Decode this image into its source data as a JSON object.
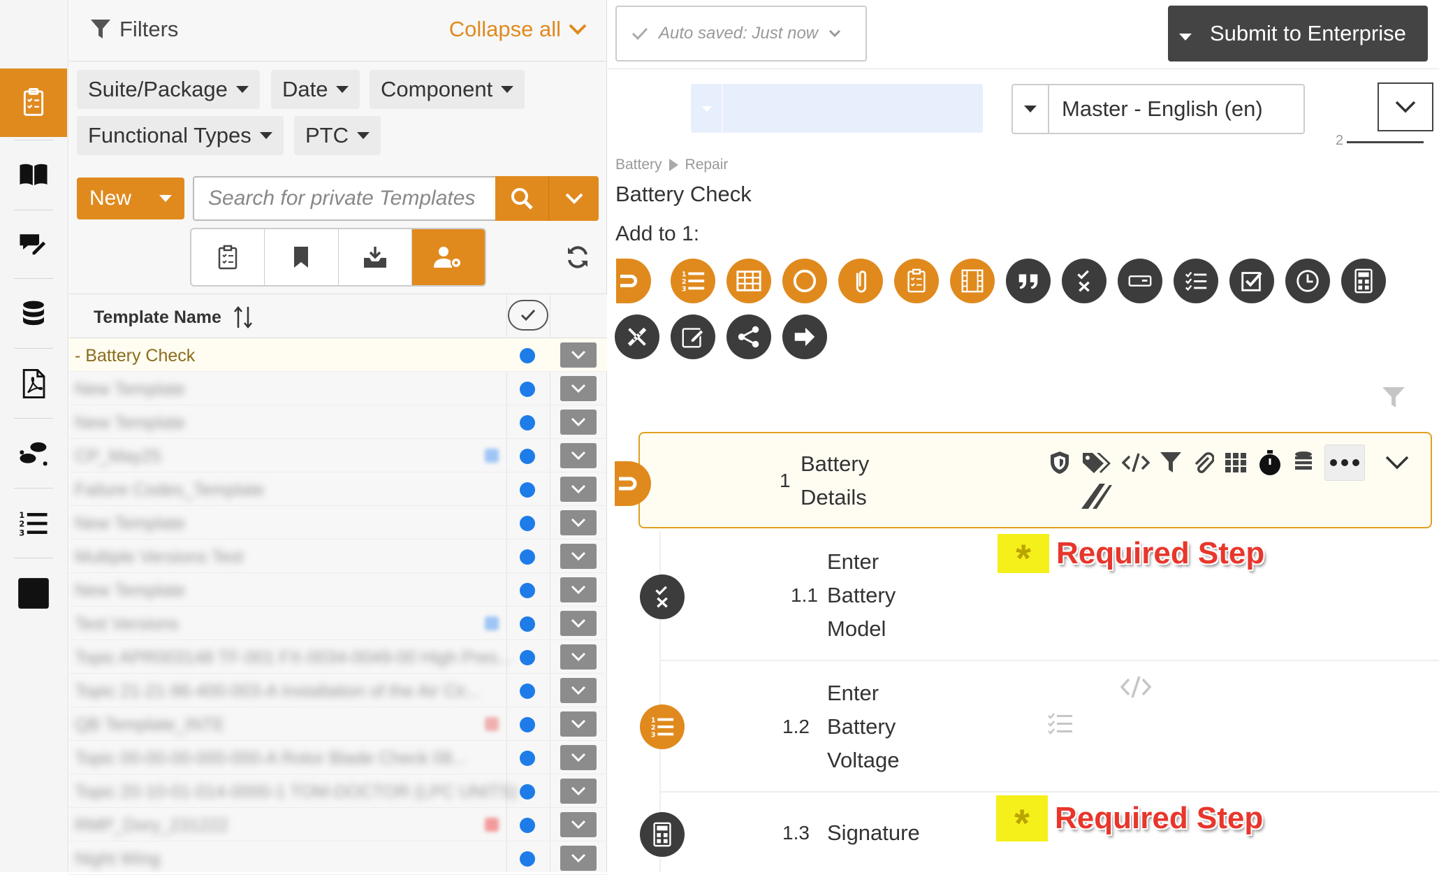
{
  "rail": {
    "items": [
      "templates-icon",
      "book-icon",
      "comments-edit-icon",
      "database-icon",
      "pdf-file-icon",
      "footsteps-icon",
      "numbered-list-icon",
      "stop-square-icon"
    ]
  },
  "filters": {
    "title": "Filters",
    "collapse_label": "Collapse all",
    "chips": [
      "Suite/Package",
      "Date",
      "Component",
      "Functional Types",
      "PTC"
    ]
  },
  "search": {
    "new_label": "New",
    "placeholder": "Search for private Templates"
  },
  "table": {
    "header_name": "Template Name",
    "rows": [
      "- Battery Check",
      "New Template",
      "New Template",
      "CP_May25",
      "Failure Codes_Template",
      "New Template",
      "Multiple Versions Test",
      "New Template",
      "Test Versions",
      "Topic APR003148 TF-001 FX-0034-0049-00 High Pres...",
      "Topic 21-21-96-400-003-A Installation of the Air Cir...",
      "QB Template_INTE",
      "Topic 00-00-00-000-000-A Rotor Blade Check 08...",
      "Topic 20-10-01-014-0000-1 TOM-DOCTOR (LPC UNITS)",
      "RMP_Dory_231222",
      "Night Wing"
    ]
  },
  "editor": {
    "autosave": "Auto saved: Just now",
    "submit": "Submit to Enterprise",
    "language": "Master - English (en)",
    "page_indicator": "2",
    "breadcrumb": [
      "Battery",
      "Repair"
    ],
    "template_title": "Battery Check",
    "add_to": "Add to 1:",
    "tools_orange": [
      "signoff-icon",
      "numbered-list-icon",
      "table-icon",
      "circle-icon",
      "attachment-icon",
      "checklist-doc-icon",
      "film-icon"
    ],
    "tools_dark": [
      "quote-icon",
      "check-x-icon",
      "input-field-icon",
      "checklist-icon",
      "checkbox-icon",
      "clock-icon",
      "calculator-icon",
      "ruler-pencil-icon",
      "edit-note-icon",
      "branch-icon",
      "arrow-right-icon"
    ],
    "steps": [
      {
        "num": "1",
        "lines": [
          "Battery",
          "Details"
        ]
      },
      {
        "num": "1.1",
        "lines": [
          "Enter",
          "Battery",
          "Model"
        ],
        "required": "Required Step"
      },
      {
        "num": "1.2",
        "lines": [
          "Enter",
          "Battery",
          "Voltage"
        ]
      },
      {
        "num": "1.3",
        "lines": [
          "Signature"
        ],
        "required": "Required Step"
      }
    ]
  },
  "colors": {
    "accent": "#e08a1e",
    "dark": "#3c3c3c",
    "blue_dot": "#1e7ce8",
    "required_red": "#e8362c",
    "highlight": "#f5f01a"
  }
}
